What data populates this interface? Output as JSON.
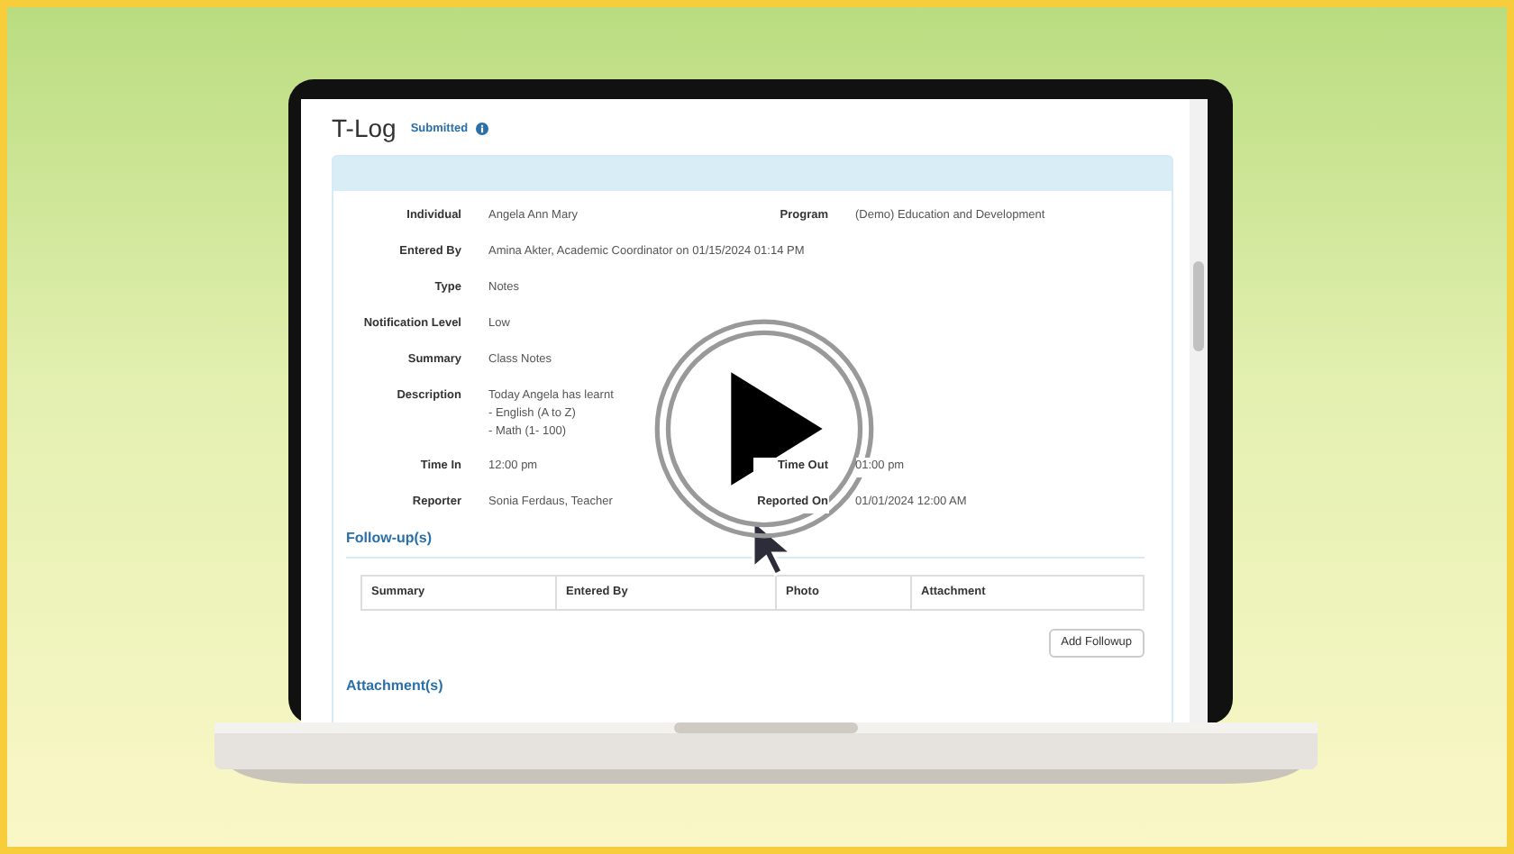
{
  "page": {
    "title": "T-Log",
    "status": "Submitted"
  },
  "details": [
    {
      "fields": [
        {
          "label": "Individual",
          "lines": [
            "Angela Ann Mary"
          ]
        },
        {
          "label": "Program",
          "lines": [
            "(Demo) Education and Development"
          ]
        }
      ]
    },
    {
      "fields": [
        {
          "label": "Entered By",
          "lines": [
            "Amina Akter, Academic Coordinator on 01/15/2024 01:14 PM"
          ]
        }
      ]
    },
    {
      "fields": [
        {
          "label": "Type",
          "lines": [
            "Notes"
          ]
        }
      ]
    },
    {
      "fields": [
        {
          "label": "Notification Level",
          "lines": [
            "Low"
          ]
        }
      ]
    },
    {
      "fields": [
        {
          "label": "Summary",
          "lines": [
            "Class Notes"
          ]
        }
      ]
    },
    {
      "fields": [
        {
          "label": "Description",
          "lines": [
            "Today Angela has learnt",
            "- English (A to Z)",
            "- Math (1- 100)"
          ]
        }
      ]
    },
    {
      "fields": [
        {
          "label": "Time In",
          "lines": [
            "12:00 pm"
          ]
        },
        {
          "label": "Time Out",
          "lines": [
            "01:00 pm"
          ]
        }
      ]
    },
    {
      "fields": [
        {
          "label": "Reporter",
          "lines": [
            "Sonia Ferdaus, Teacher"
          ]
        },
        {
          "label": "Reported On",
          "lines": [
            "01/01/2024 12:00 AM"
          ]
        }
      ]
    }
  ],
  "followups": {
    "title": "Follow-up(s)",
    "columns": [
      "Summary",
      "Entered By",
      "Photo",
      "Attachment"
    ],
    "button": "Add Followup"
  },
  "attachments": {
    "title": "Attachment(s)"
  }
}
